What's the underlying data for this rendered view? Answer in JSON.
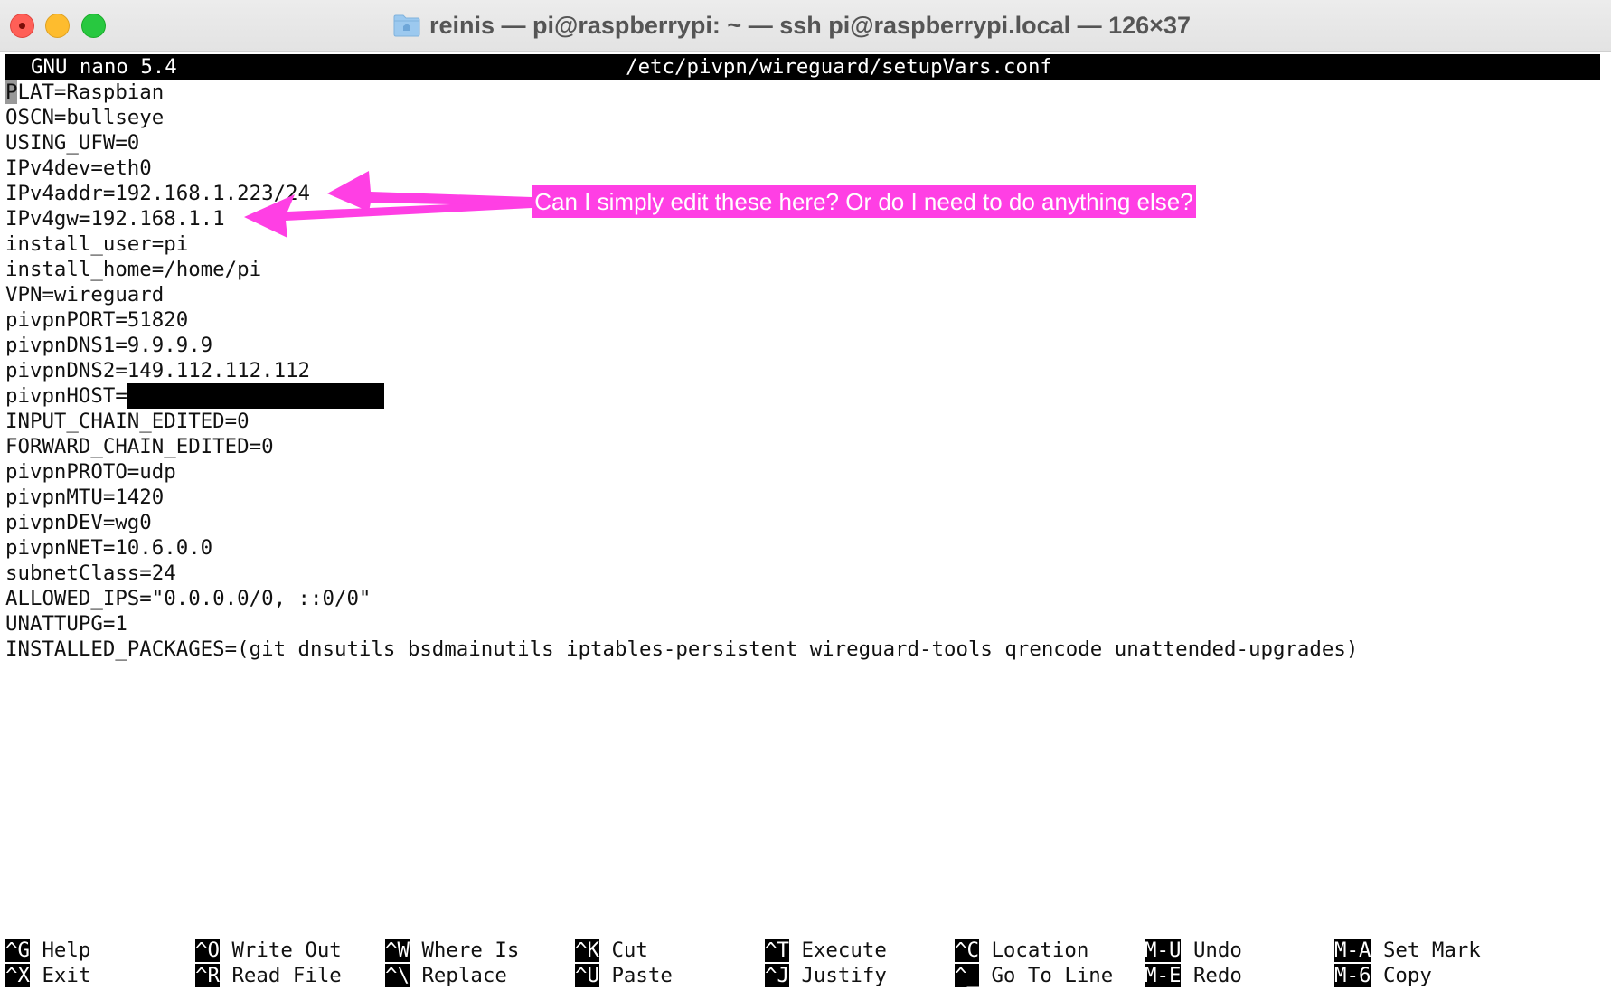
{
  "window": {
    "title": "reinis — pi@raspberrypi: ~ — ssh pi@raspberrypi.local — 126×37"
  },
  "nano": {
    "version": "GNU nano 5.4",
    "filename": "/etc/pivpn/wireguard/setupVars.conf"
  },
  "lines": [
    "PLAT=Raspbian",
    "OSCN=bullseye",
    "USING_UFW=0",
    "IPv4dev=eth0",
    "IPv4addr=192.168.1.223/24",
    "IPv4gw=192.168.1.1",
    "install_user=pi",
    "install_home=/home/pi",
    "VPN=wireguard",
    "pivpnPORT=51820",
    "pivpnDNS1=9.9.9.9",
    "pivpnDNS2=149.112.112.112",
    "pivpnHOST=",
    "INPUT_CHAIN_EDITED=0",
    "FORWARD_CHAIN_EDITED=0",
    "pivpnPROTO=udp",
    "pivpnMTU=1420",
    "pivpnDEV=wg0",
    "pivpnNET=10.6.0.0",
    "subnetClass=24",
    "ALLOWED_IPS=\"0.0.0.0/0, ::0/0\"",
    "UNATTUPG=1",
    "INSTALLED_PACKAGES=(git dnsutils bsdmainutils iptables-persistent wireguard-tools qrencode unattended-upgrades)"
  ],
  "cursor_char": "P",
  "shortcuts": [
    {
      "key": "^G",
      "label": "Help"
    },
    {
      "key": "^X",
      "label": "Exit"
    },
    {
      "key": "^O",
      "label": "Write Out"
    },
    {
      "key": "^R",
      "label": "Read File"
    },
    {
      "key": "^W",
      "label": "Where Is"
    },
    {
      "key": "^\\",
      "label": "Replace"
    },
    {
      "key": "^K",
      "label": "Cut"
    },
    {
      "key": "^U",
      "label": "Paste"
    },
    {
      "key": "^T",
      "label": "Execute"
    },
    {
      "key": "^J",
      "label": "Justify"
    },
    {
      "key": "^C",
      "label": "Location"
    },
    {
      "key": "^_",
      "label": "Go To Line"
    },
    {
      "key": "M-U",
      "label": "Undo"
    },
    {
      "key": "M-E",
      "label": "Redo"
    },
    {
      "key": "M-A",
      "label": "Set Mark"
    },
    {
      "key": "M-6",
      "label": "Copy"
    }
  ],
  "annotation": {
    "text": "Can I simply edit these here? Or do I need to do anything else?",
    "color": "#ff3fe4"
  }
}
